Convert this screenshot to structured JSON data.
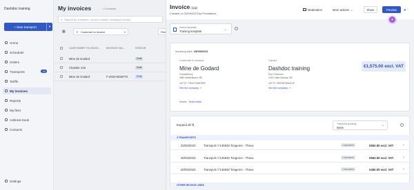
{
  "sidebar": {
    "brand": "Dashdoc training",
    "new_transport": "+ New transport",
    "items": [
      {
        "label": "Home",
        "icon": "home-icon"
      },
      {
        "label": "Scheduler",
        "icon": "calendar-icon"
      },
      {
        "label": "Orders",
        "icon": "box-icon"
      },
      {
        "label": "Transports",
        "icon": "truck-icon",
        "badge": "15"
      },
      {
        "label": "Tariffs",
        "icon": "tag-icon"
      },
      {
        "label": "My invoices",
        "icon": "invoice-icon",
        "active": true
      },
      {
        "label": "Reports",
        "icon": "chart-icon"
      },
      {
        "label": "My fleet",
        "icon": "fleet-icon"
      },
      {
        "label": "Address book",
        "icon": "book-icon"
      },
      {
        "label": "Contacts",
        "icon": "contacts-icon"
      }
    ],
    "settings": "Settings"
  },
  "list": {
    "title": "My invoices",
    "count": "• 3 invoices",
    "search_placeholder": "Search by customer, invoice number, transport numbe",
    "filter_label": "Customer to invoice",
    "filter2": "Peri",
    "columns": [
      "CUSTOMER TO INVOI...",
      "INVOICE NU...",
      "STATUS"
    ],
    "rows": [
      {
        "customer": "Mine de Godard",
        "invoice": "",
        "status": "Draft",
        "status_style": "grey"
      },
      {
        "customer": "Chantier 418",
        "invoice": "",
        "status": "Draft",
        "status_style": "grey"
      },
      {
        "customer": "Mine de Godard",
        "invoice": "F-2023-0028770",
        "status": "Final",
        "status_style": "blue"
      }
    ]
  },
  "detail": {
    "title": "Invoice",
    "status": "Draft",
    "created": "Created on 29/09/2023 by Prestations",
    "moderation": "Moderation",
    "more_actions": "More actions",
    "share": "Share",
    "preview": "Preview",
    "template_label": "Invoice template",
    "template_value": "Training template",
    "invoicing_date_label": "Invoicing date:",
    "invoicing_date": "29/09/2023",
    "customer_section": "Customer to invoice",
    "customer_name": "Mine de Godard",
    "customer_addr": [
      "Grandefleury",
      "3861 Mallersbach, BE"
    ],
    "customer_vat": "VAT N°: FR42134567890",
    "customer_link": "See the company",
    "carrier_section": "Carrier",
    "carrier_name": "Dashdoc training",
    "carrier_addr": [
      "Rue Chevreux",
      "1420 Saint-Nicolas, BE"
    ],
    "carrier_vat": "VAT N°: BE0987654321F",
    "carrier_link": "See the company",
    "amount": "€1,575.00 excl. VAT",
    "notes_label": "Notes",
    "notes_link": "Add notes",
    "expand_all": "Expand all",
    "grouping_label": "Transports grouping",
    "grouping_value": "None",
    "transports_header": "3 TRANSPORTS",
    "transports": [
      {
        "date": "20/03/2023",
        "title": "Transport n°145832 Tongeren - Theux",
        "docs": "1 document",
        "amount": "€562.50 excl. VAT"
      },
      {
        "date": "20/03/2023",
        "title": "Transport n°145832 Tongeren - Theux",
        "docs": "1 document",
        "amount": "€562.50 excl. VAT"
      },
      {
        "date": "20/03/2023",
        "title": "Transport n°145832 Tongeren - Theux",
        "docs": "1 document",
        "amount": "€450.00 excl. VAT"
      }
    ],
    "other_lines_header": "OTHER INVOICE LINES"
  }
}
